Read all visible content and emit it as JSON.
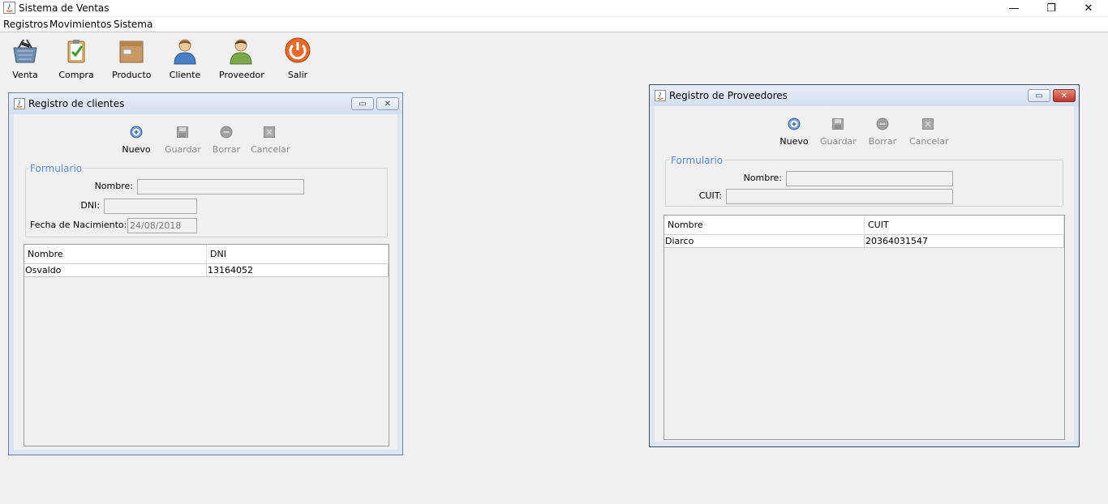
{
  "window": {
    "title": "Sistema de Ventas",
    "controls": {
      "minimize": "—",
      "maximize": "❐",
      "close": "✕"
    }
  },
  "menubar": {
    "items": [
      "Registros",
      "Movimientos",
      "Sistema"
    ]
  },
  "toolbar": {
    "items": [
      {
        "label": "Venta",
        "icon": "basket-icon"
      },
      {
        "label": "Compra",
        "icon": "clipboard-check-icon"
      },
      {
        "label": "Producto",
        "icon": "box-icon"
      },
      {
        "label": "Cliente",
        "icon": "person-icon"
      },
      {
        "label": "Proveedor",
        "icon": "supplier-person-icon"
      },
      {
        "label": "Salir",
        "icon": "power-icon"
      }
    ]
  },
  "clientes": {
    "title": "Registro de clientes",
    "actions": {
      "nuevo": "Nuevo",
      "guardar": "Guardar",
      "borrar": "Borrar",
      "cancelar": "Cancelar"
    },
    "form": {
      "legend": "Formulario",
      "nombre_label": "Nombre:",
      "nombre_value": "",
      "dni_label": "DNI:",
      "dni_value": "",
      "fecha_label": "Fecha de Nacimiento:",
      "fecha_value": "24/08/2018"
    },
    "table": {
      "columns": [
        "Nombre",
        "DNI"
      ],
      "rows": [
        [
          "Osvaldo",
          "13164052"
        ]
      ]
    }
  },
  "proveedores": {
    "title": "Registro de Proveedores",
    "actions": {
      "nuevo": "Nuevo",
      "guardar": "Guardar",
      "borrar": "Borrar",
      "cancelar": "Cancelar"
    },
    "form": {
      "legend": "Formulario",
      "nombre_label": "Nombre:",
      "nombre_value": "",
      "cuit_label": "CUIT:",
      "cuit_value": ""
    },
    "table": {
      "columns": [
        "Nombre",
        "CUIT"
      ],
      "rows": [
        [
          "Diarco",
          "20364031547"
        ]
      ]
    }
  },
  "colors": {
    "legend": "#5b8bd6",
    "frame_border": "#6b7e9a",
    "close_red": "#c2362a"
  }
}
